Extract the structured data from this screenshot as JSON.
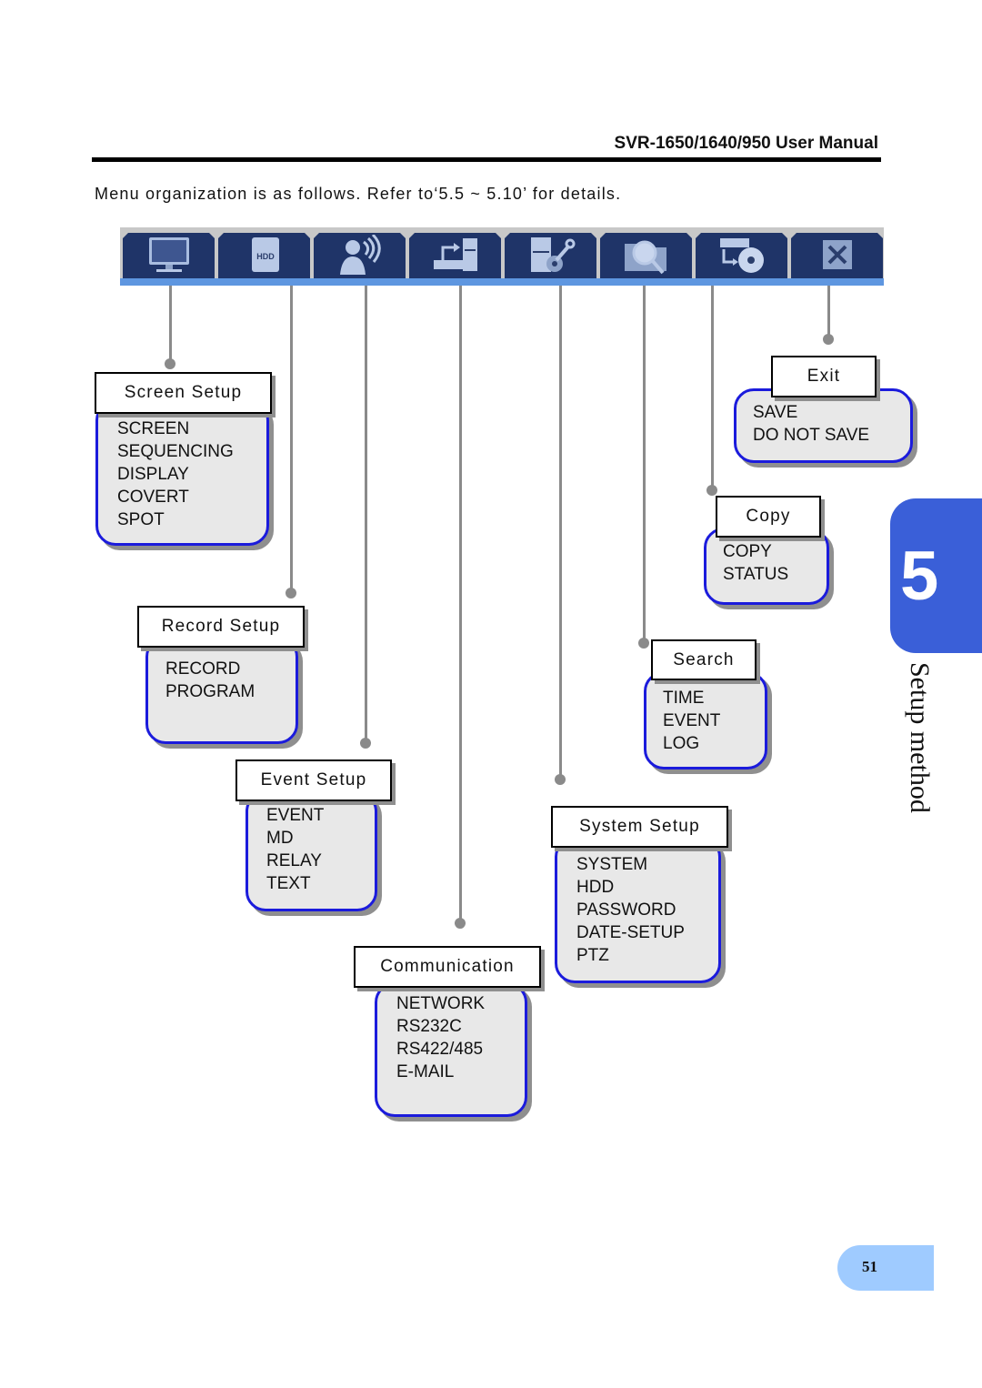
{
  "header": {
    "title": "SVR-1650/1640/950 User Manual"
  },
  "intro": "Menu organization is as follows. Refer to‘5.5 ~ 5.10’ for details.",
  "toolbar": {
    "tabs": [
      {
        "icon": "monitor-icon",
        "label": "Screen Setup"
      },
      {
        "icon": "hdd-icon",
        "label": "Record Setup"
      },
      {
        "icon": "event-person-icon",
        "label": "Event Setup"
      },
      {
        "icon": "communication-icon",
        "label": "Communication"
      },
      {
        "icon": "system-wrench-icon",
        "label": "System Setup"
      },
      {
        "icon": "search-folder-icon",
        "label": "Search"
      },
      {
        "icon": "copy-disc-icon",
        "label": "Copy"
      },
      {
        "icon": "close-icon",
        "label": "Exit"
      }
    ],
    "hdd_text": "HDD"
  },
  "menus": {
    "screen_setup": {
      "title": "Screen Setup",
      "items": [
        "SCREEN",
        "SEQUENCING",
        "DISPLAY",
        "COVERT",
        "SPOT"
      ]
    },
    "record_setup": {
      "title": "Record Setup",
      "items": [
        "RECORD",
        "PROGRAM"
      ]
    },
    "event_setup": {
      "title": "Event Setup",
      "items": [
        "EVENT",
        "MD",
        "RELAY",
        "TEXT"
      ]
    },
    "communication": {
      "title": "Communication",
      "items": [
        "NETWORK",
        "RS232C",
        "RS422/485",
        "E-MAIL"
      ]
    },
    "system_setup": {
      "title": "System Setup",
      "items": [
        "SYSTEM",
        "HDD",
        "PASSWORD",
        "DATE-SETUP",
        "PTZ"
      ]
    },
    "search": {
      "title": "Search",
      "items": [
        "TIME",
        "EVENT",
        "LOG"
      ]
    },
    "copy": {
      "title": "Copy",
      "items": [
        "COPY",
        "STATUS"
      ]
    },
    "exit": {
      "title": "Exit",
      "items": [
        "SAVE",
        "DO NOT SAVE"
      ]
    }
  },
  "chapter": {
    "number": "5",
    "label": "Setup method"
  },
  "page_number": "51"
}
